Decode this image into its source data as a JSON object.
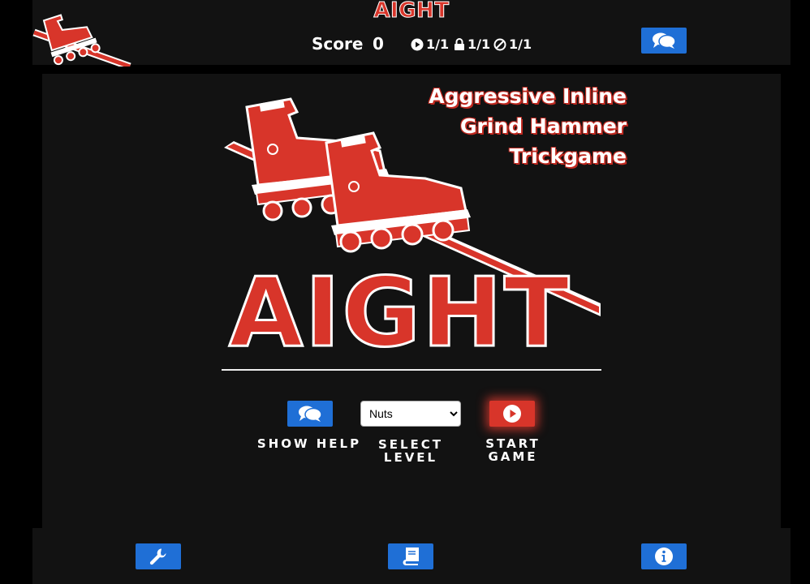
{
  "header": {
    "app_title": "AIGHT",
    "score_label": "Score",
    "score_value": "0",
    "stats": {
      "played": "1/1",
      "locked": "1/1",
      "blocked": "1/1"
    }
  },
  "splash": {
    "tagline_line1": "Aggressive Inline",
    "tagline_line2": "Grind Hammer",
    "tagline_line3": "Trickgame",
    "logo_text": "AIGHT"
  },
  "controls": {
    "help_label": "SHOW HELP",
    "level_label_line1": "SELECT",
    "level_label_line2": "LEVEL",
    "level_selected": "Nuts",
    "start_label_line1": "START",
    "start_label_line2": "GAME"
  },
  "colors": {
    "accent_red": "#d8352a",
    "button_blue": "#1f6fd6",
    "panel_bg": "#121212"
  },
  "icons": {
    "chat": "chat-icon",
    "play": "play-icon",
    "lock": "lock-icon",
    "no": "no-entry-icon",
    "wrench": "wrench-icon",
    "book": "book-icon",
    "info": "info-icon"
  }
}
